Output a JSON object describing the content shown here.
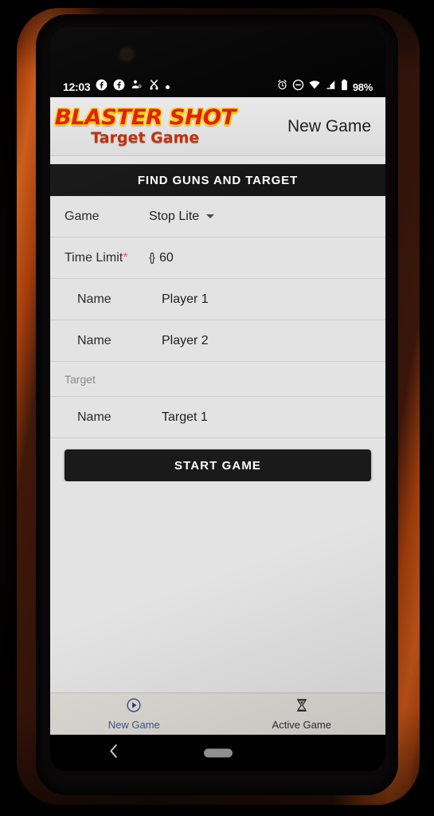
{
  "status_bar": {
    "time": "12:03",
    "battery_percent": "98%",
    "left_icons": [
      "facebook-icon",
      "facebook-icon",
      "person-add-icon",
      "scissors-icon",
      "dot-icon"
    ],
    "right_icons": [
      "alarm-icon",
      "do-not-disturb-icon",
      "wifi-icon",
      "signal-icon",
      "battery-icon"
    ]
  },
  "app_bar": {
    "logo_line1": "BLASTER SHOT",
    "logo_line2": "Target Game",
    "title": "New Game",
    "logo_color_primary": "#e01b0c",
    "logo_color_outline": "#ffd200",
    "logo_color_secondary": "#c62b07"
  },
  "section_button": {
    "label": "FIND GUNS AND TARGET"
  },
  "form": {
    "rows": [
      {
        "label": "Game",
        "required": false,
        "value": "Stop Lite",
        "control": "dropdown",
        "indent": false,
        "prefix": ""
      },
      {
        "label": "Time Limit",
        "required": true,
        "value": "60",
        "control": "number",
        "indent": false,
        "prefix": "{}"
      },
      {
        "label": "Name",
        "required": false,
        "value": "Player 1",
        "control": "text",
        "indent": true,
        "prefix": ""
      },
      {
        "label": "Name",
        "required": false,
        "value": "Player 2",
        "control": "text",
        "indent": true,
        "prefix": ""
      }
    ],
    "section_header": "Target",
    "target_row": {
      "label": "Name",
      "value": "Target 1",
      "control": "text"
    },
    "required_marker": "*"
  },
  "start_button": {
    "label": "START GAME"
  },
  "tab_bar": {
    "tabs": [
      {
        "label": "New Game",
        "icon": "play-circle-icon",
        "active": true
      },
      {
        "label": "Active Game",
        "icon": "hourglass-icon",
        "active": false
      }
    ],
    "active_color": "#3c5a8a"
  },
  "nav_bar": {
    "back_icon": "chevron-left-icon",
    "home_icon": "home-pill-icon"
  }
}
